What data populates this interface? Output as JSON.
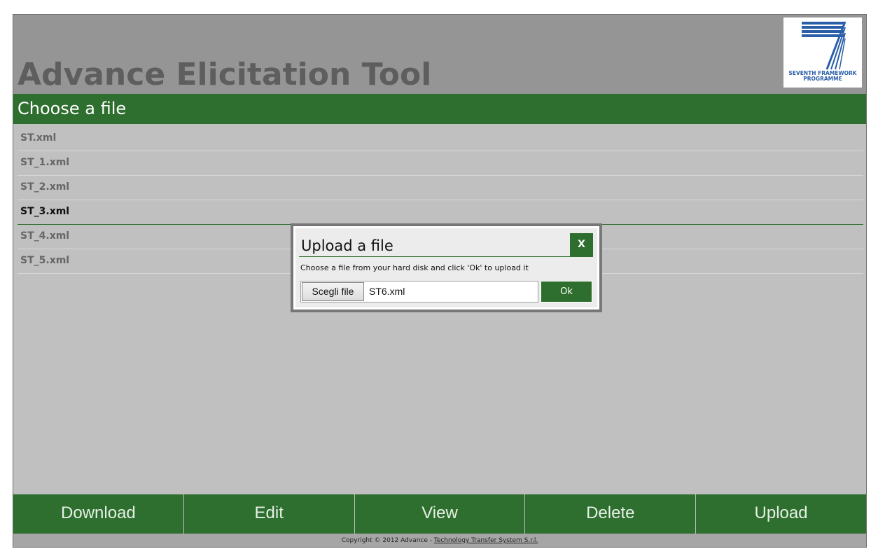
{
  "header": {
    "title": "Advance Elicitation Tool",
    "logo": {
      "icon": "fp7-seven-icon",
      "line1": "SEVENTH FRAMEWORK",
      "line2": "PROGRAMME",
      "color": "#2a5ea8"
    }
  },
  "section": {
    "title": "Choose a file"
  },
  "files": [
    {
      "name": "ST.xml",
      "selected": false
    },
    {
      "name": "ST_1.xml",
      "selected": false
    },
    {
      "name": "ST_2.xml",
      "selected": false
    },
    {
      "name": "ST_3.xml",
      "selected": true
    },
    {
      "name": "ST_4.xml",
      "selected": false
    },
    {
      "name": "ST_5.xml",
      "selected": false
    }
  ],
  "toolbar": {
    "download_label": "Download",
    "edit_label": "Edit",
    "view_label": "View",
    "delete_label": "Delete",
    "upload_label": "Upload"
  },
  "footer": {
    "copyright": "Copyright © 2012 Advance - ",
    "link_text": "Technology Transfer System S.r.l."
  },
  "modal": {
    "title": "Upload a file",
    "close_label": "X",
    "description": "Choose a file from your hard disk and click 'Ok' to upload it",
    "choose_button_label": "Scegli file",
    "selected_file": "ST6.xml",
    "ok_label": "Ok"
  },
  "colors": {
    "accent_green": "#2e6e2e",
    "header_gray": "#959595",
    "panel_gray": "#c0c0c0"
  }
}
